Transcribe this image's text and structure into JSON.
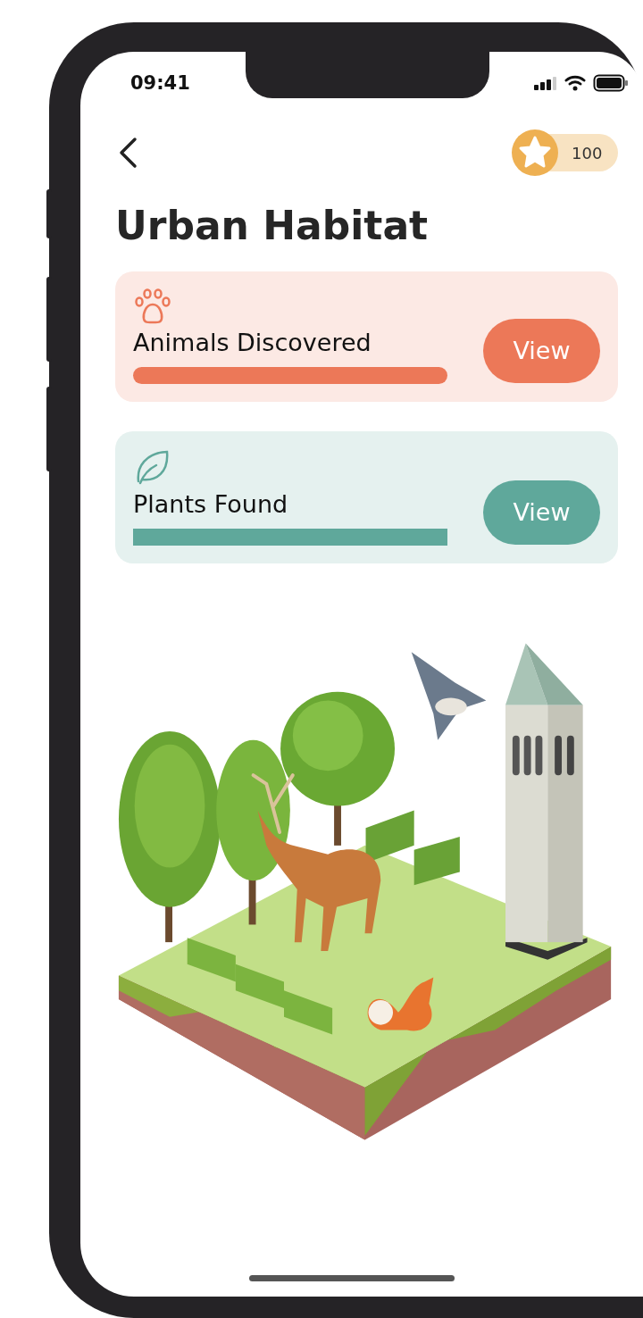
{
  "status_bar": {
    "time": "09:41"
  },
  "header": {
    "points": "100"
  },
  "title": "Urban Habitat",
  "cards": [
    {
      "kind": "animals",
      "label": "Animals Discovered",
      "color": "#ec7858",
      "button": "View"
    },
    {
      "kind": "plants",
      "label": "Plants Found",
      "color": "#5fa89b",
      "button": "View"
    }
  ]
}
